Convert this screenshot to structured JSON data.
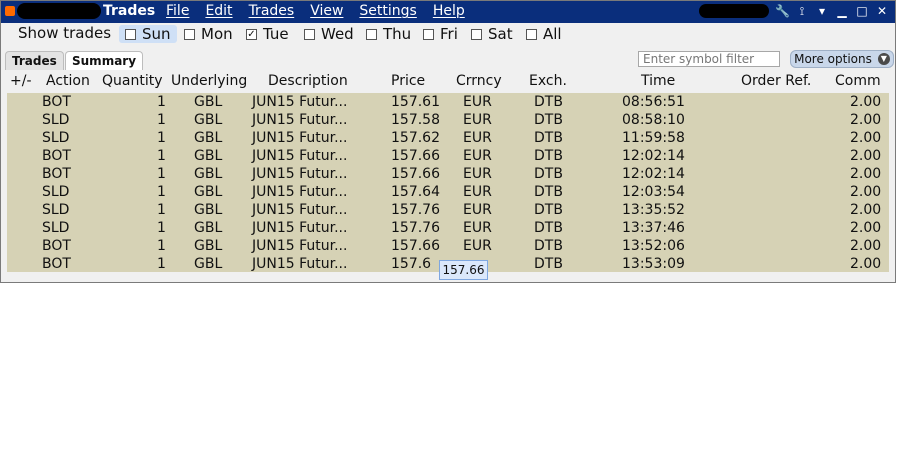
{
  "window": {
    "title": "Trades",
    "menu": [
      "File",
      "Edit",
      "Trades",
      "View",
      "Settings",
      "Help"
    ]
  },
  "filter": {
    "label": "Show trades",
    "days": [
      {
        "label": "Sun",
        "checked": false,
        "highlighted": true
      },
      {
        "label": "Mon",
        "checked": false
      },
      {
        "label": "Tue",
        "checked": true
      },
      {
        "label": "Wed",
        "checked": false
      },
      {
        "label": "Thu",
        "checked": false
      },
      {
        "label": "Fri",
        "checked": false
      },
      {
        "label": "Sat",
        "checked": false
      },
      {
        "label": "All",
        "checked": false
      }
    ]
  },
  "tabs": [
    {
      "label": "Trades"
    },
    {
      "label": "Summary"
    }
  ],
  "search": {
    "placeholder": "Enter symbol filter"
  },
  "more_options": {
    "label": "More options"
  },
  "table": {
    "headers": [
      "+/-",
      "Action",
      "Quantity",
      "Underlying",
      "Description",
      "Price",
      "Crrncy",
      "Exch.",
      "Time",
      "Order Ref.",
      "Comm"
    ],
    "rows": [
      {
        "action": "BOT",
        "quantity": "1",
        "underlying": "GBL",
        "description": "JUN15 Futur...",
        "price": "157.61",
        "currency": "EUR",
        "exchange": "DTB",
        "time": "08:56:51",
        "order_ref": "",
        "comm": "2.00"
      },
      {
        "action": "SLD",
        "quantity": "1",
        "underlying": "GBL",
        "description": "JUN15 Futur...",
        "price": "157.58",
        "currency": "EUR",
        "exchange": "DTB",
        "time": "08:58:10",
        "order_ref": "",
        "comm": "2.00"
      },
      {
        "action": "SLD",
        "quantity": "1",
        "underlying": "GBL",
        "description": "JUN15 Futur...",
        "price": "157.62",
        "currency": "EUR",
        "exchange": "DTB",
        "time": "11:59:58",
        "order_ref": "",
        "comm": "2.00"
      },
      {
        "action": "BOT",
        "quantity": "1",
        "underlying": "GBL",
        "description": "JUN15 Futur...",
        "price": "157.66",
        "currency": "EUR",
        "exchange": "DTB",
        "time": "12:02:14",
        "order_ref": "",
        "comm": "2.00"
      },
      {
        "action": "BOT",
        "quantity": "1",
        "underlying": "GBL",
        "description": "JUN15 Futur...",
        "price": "157.66",
        "currency": "EUR",
        "exchange": "DTB",
        "time": "12:02:14",
        "order_ref": "",
        "comm": "2.00"
      },
      {
        "action": "SLD",
        "quantity": "1",
        "underlying": "GBL",
        "description": "JUN15 Futur...",
        "price": "157.64",
        "currency": "EUR",
        "exchange": "DTB",
        "time": "12:03:54",
        "order_ref": "",
        "comm": "2.00"
      },
      {
        "action": "SLD",
        "quantity": "1",
        "underlying": "GBL",
        "description": "JUN15 Futur...",
        "price": "157.76",
        "currency": "EUR",
        "exchange": "DTB",
        "time": "13:35:52",
        "order_ref": "",
        "comm": "2.00"
      },
      {
        "action": "SLD",
        "quantity": "1",
        "underlying": "GBL",
        "description": "JUN15 Futur...",
        "price": "157.76",
        "currency": "EUR",
        "exchange": "DTB",
        "time": "13:37:46",
        "order_ref": "",
        "comm": "2.00"
      },
      {
        "action": "BOT",
        "quantity": "1",
        "underlying": "GBL",
        "description": "JUN15 Futur...",
        "price": "157.66",
        "currency": "EUR",
        "exchange": "DTB",
        "time": "13:52:06",
        "order_ref": "",
        "comm": "2.00"
      },
      {
        "action": "BOT",
        "quantity": "1",
        "underlying": "GBL",
        "description": "JUN15 Futur...",
        "price": "157.6",
        "currency": "",
        "exchange": "DTB",
        "time": "13:53:09",
        "order_ref": "",
        "comm": "2.00"
      }
    ]
  },
  "tooltip": {
    "text": "157.66"
  },
  "colors": {
    "titlebar": "#0a2e7c",
    "grid_bg": "#d6d2b5",
    "accent": "#cfe0f6"
  }
}
